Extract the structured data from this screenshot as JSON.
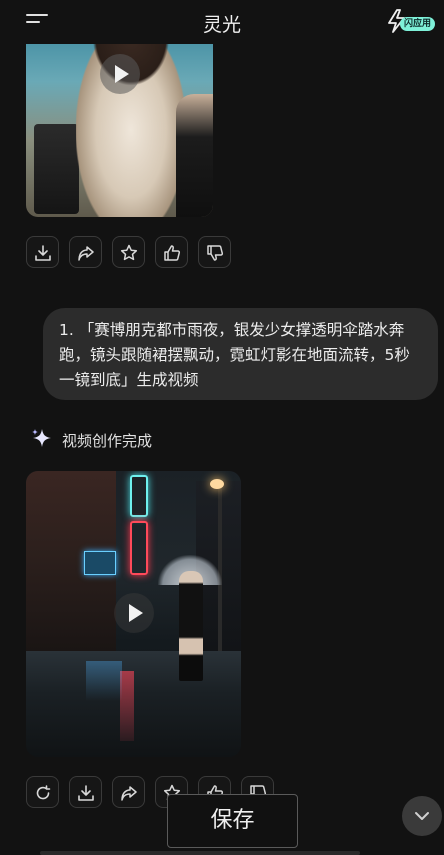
{
  "header": {
    "title": "灵光",
    "menu_icon": "menu-icon",
    "flash_app_label": "闪应用"
  },
  "video_top": {
    "play_icon": "play-icon"
  },
  "actions_top": [
    {
      "icon": "download-icon"
    },
    {
      "icon": "share-icon"
    },
    {
      "icon": "star-icon"
    },
    {
      "icon": "thumbs-up-icon"
    },
    {
      "icon": "thumbs-down-icon"
    }
  ],
  "user_message": {
    "text": "1. 「赛博朋克都市雨夜，银发少女撑透明伞踏水奔跑，镜头跟随裙摆飘动，霓虹灯影在地面流转，5秒一镜到底」生成视频"
  },
  "status": {
    "icon": "sparkle-icon",
    "text": "视频创作完成"
  },
  "video_main": {
    "play_icon": "play-icon"
  },
  "actions_bottom": [
    {
      "icon": "regenerate-icon"
    },
    {
      "icon": "download-icon"
    },
    {
      "icon": "share-icon"
    },
    {
      "icon": "star-icon"
    },
    {
      "icon": "thumbs-up-icon"
    },
    {
      "icon": "thumbs-down-icon"
    }
  ],
  "save_toast": {
    "label": "保存"
  },
  "scroll_button": {
    "icon": "chevron-down-icon"
  },
  "colors": {
    "background": "#121212",
    "bubble": "#2c2c2c",
    "accent_badge": "#7ef0d8"
  }
}
